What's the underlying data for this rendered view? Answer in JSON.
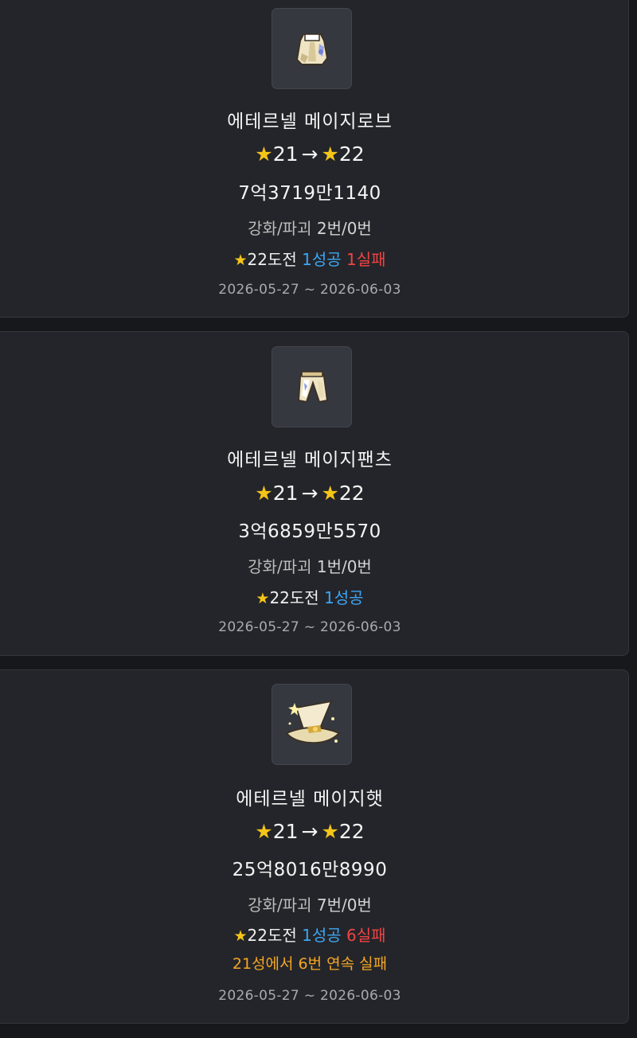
{
  "items": [
    {
      "icon": "robe-icon",
      "name": "에테르넬 메이지로브",
      "star_from": "21",
      "arrow": "→",
      "star_to": "22",
      "price": "7억3719만1140",
      "counts_label": "강화/파괴",
      "counts_value": "2번/0번",
      "challenge_star": "22도전",
      "success": "1성공",
      "fail": "1실패",
      "streak": "",
      "date_range": "2026-05-27 ~ 2026-06-03"
    },
    {
      "icon": "pants-icon",
      "name": "에테르넬 메이지팬츠",
      "star_from": "21",
      "arrow": "→",
      "star_to": "22",
      "price": "3억6859만5570",
      "counts_label": "강화/파괴",
      "counts_value": "1번/0번",
      "challenge_star": "22도전",
      "success": "1성공",
      "fail": "",
      "streak": "",
      "date_range": "2026-05-27 ~ 2026-06-03"
    },
    {
      "icon": "hat-icon",
      "name": "에테르넬 메이지햇",
      "star_from": "21",
      "arrow": "→",
      "star_to": "22",
      "price": "25억8016만8990",
      "counts_label": "강화/파괴",
      "counts_value": "7번/0번",
      "challenge_star": "22도전",
      "success": "1성공",
      "fail": "6실패",
      "streak": "21성에서 6번 연속 실패",
      "date_range": "2026-05-27 ~ 2026-06-03"
    }
  ],
  "colors": {
    "star": "#f5c518",
    "success": "#3ca6f2",
    "fail": "#ef4444",
    "streak": "#f5a623"
  }
}
